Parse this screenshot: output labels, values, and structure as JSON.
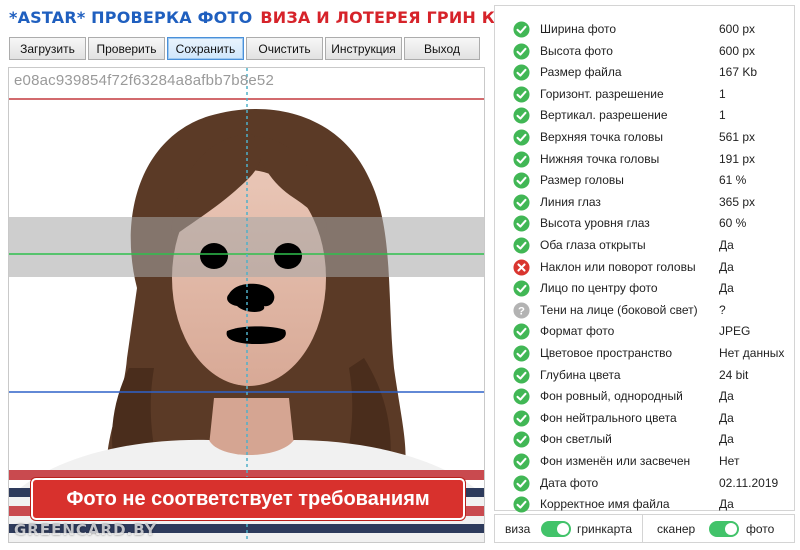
{
  "header": {
    "title_part1": "*ASTAR* ПРОВЕРКА ФОТО",
    "title_part2": "ВИЗА И ЛОТЕРЕЯ ГРИН КАРТА"
  },
  "toolbar": {
    "buttons": [
      {
        "label": "Загрузить",
        "active": false
      },
      {
        "label": "Проверить",
        "active": false
      },
      {
        "label": "Сохранить",
        "active": true
      },
      {
        "label": "Очистить",
        "active": false
      },
      {
        "label": "Инструкция",
        "active": false
      },
      {
        "label": "Выход",
        "active": false
      }
    ]
  },
  "photo": {
    "file_hash": "e08ac939854f72f63284a8afbb7b8e52",
    "error_message": "Фото не соответствует требованиям",
    "watermark": "GREENCARD.BY"
  },
  "colors": {
    "pass": "#41b755",
    "fail": "#d9352f",
    "unknown": "#b3b3b3",
    "toggle_on": "#42c36a",
    "title_blue": "#1f5fbf",
    "title_red": "#d6232a"
  },
  "checks": [
    {
      "label": "Ширина фото",
      "value": "600 px",
      "status": "pass"
    },
    {
      "label": "Высота фото",
      "value": "600 px",
      "status": "pass"
    },
    {
      "label": "Размер файла",
      "value": "167 Kb",
      "status": "pass"
    },
    {
      "label": "Горизонт. разрешение",
      "value": "1",
      "status": "pass"
    },
    {
      "label": "Вертикал. разрешение",
      "value": "1",
      "status": "pass"
    },
    {
      "label": "Верхняя точка головы",
      "value": "561 px",
      "status": "pass"
    },
    {
      "label": "Нижняя точка головы",
      "value": "191 px",
      "status": "pass"
    },
    {
      "label": "Размер головы",
      "value": "61 %",
      "status": "pass"
    },
    {
      "label": "Линия глаз",
      "value": "365 px",
      "status": "pass"
    },
    {
      "label": "Высота уровня глаз",
      "value": "60 %",
      "status": "pass"
    },
    {
      "label": "Оба глаза открыты",
      "value": "Да",
      "status": "pass"
    },
    {
      "label": "Наклон или поворот головы",
      "value": "Да",
      "status": "fail"
    },
    {
      "label": "Лицо по центру фото",
      "value": "Да",
      "status": "pass"
    },
    {
      "label": "Тени на лице (боковой свет)",
      "value": "?",
      "status": "unknown"
    },
    {
      "label": "Формат фото",
      "value": "JPEG",
      "status": "pass"
    },
    {
      "label": "Цветовое пространство",
      "value": "Нет данных",
      "status": "pass"
    },
    {
      "label": "Глубина цвета",
      "value": "24 bit",
      "status": "pass"
    },
    {
      "label": "Фон ровный, однородный",
      "value": "Да",
      "status": "pass"
    },
    {
      "label": "Фон нейтрального цвета",
      "value": "Да",
      "status": "pass"
    },
    {
      "label": "Фон светлый",
      "value": "Да",
      "status": "pass"
    },
    {
      "label": "Фон изменён или засвечен",
      "value": "Нет",
      "status": "pass"
    },
    {
      "label": "Дата фото",
      "value": "02.11.2019",
      "status": "pass"
    },
    {
      "label": "Корректное имя файла",
      "value": "Да",
      "status": "pass"
    }
  ],
  "toggles": {
    "left": {
      "off_label": "виза",
      "on_label": "гринкарта",
      "state": "on"
    },
    "right": {
      "off_label": "сканер",
      "on_label": "фото",
      "state": "on"
    }
  }
}
